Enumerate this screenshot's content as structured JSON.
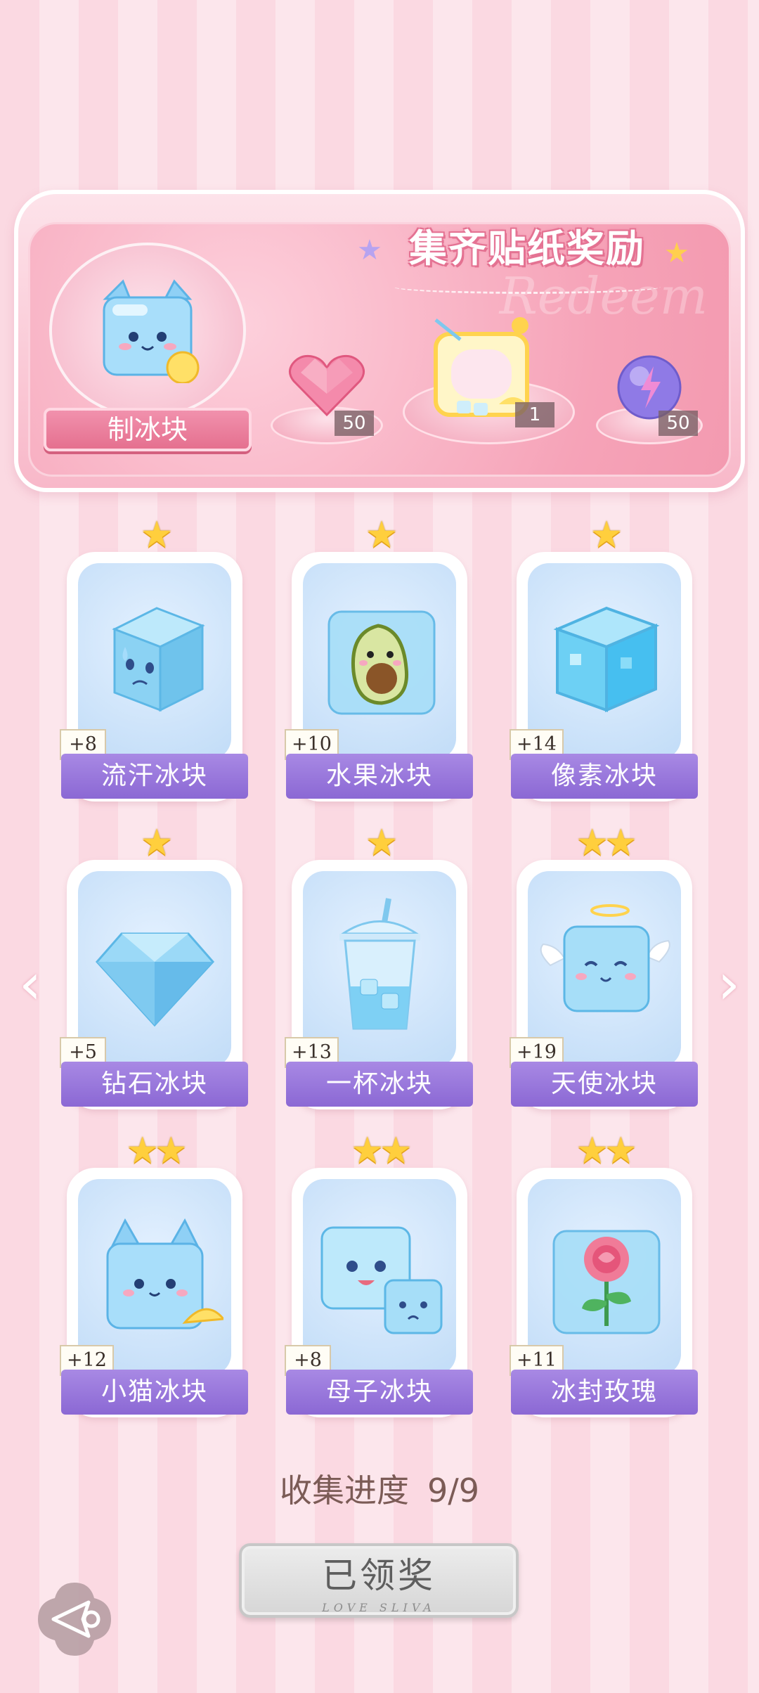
{
  "banner": {
    "title": "集齐贴纸奖励",
    "watermark": "Redeem",
    "main_reward_label": "制冰块",
    "rewards": [
      {
        "icon": "pink-heart-gem-icon",
        "qty": "50"
      },
      {
        "icon": "lemon-drink-frame-icon",
        "qty": "1"
      },
      {
        "icon": "purple-energy-orb-icon",
        "qty": "50"
      }
    ]
  },
  "cards": [
    {
      "name": "流汗冰块",
      "bonus": "+8",
      "stars": "★",
      "star_count": 1,
      "icon": "sweating-ice-cube-icon"
    },
    {
      "name": "水果冰块",
      "bonus": "+10",
      "stars": "★",
      "star_count": 1,
      "icon": "avocado-ice-cube-icon"
    },
    {
      "name": "像素冰块",
      "bonus": "+14",
      "stars": "★",
      "star_count": 1,
      "icon": "pixel-ice-cube-icon"
    },
    {
      "name": "钻石冰块",
      "bonus": "+5",
      "stars": "★",
      "star_count": 1,
      "icon": "diamond-ice-icon"
    },
    {
      "name": "一杯冰块",
      "bonus": "+13",
      "stars": "★",
      "star_count": 1,
      "icon": "cup-of-ice-icon"
    },
    {
      "name": "天使冰块",
      "bonus": "+19",
      "stars": "★★",
      "star_count": 2,
      "icon": "angel-ice-cube-icon"
    },
    {
      "name": "小猫冰块",
      "bonus": "+12",
      "stars": "★★",
      "star_count": 2,
      "icon": "cat-ice-cube-icon"
    },
    {
      "name": "母子冰块",
      "bonus": "+8",
      "stars": "★★",
      "star_count": 2,
      "icon": "mother-child-ice-cube-icon"
    },
    {
      "name": "冰封玫瑰",
      "bonus": "+11",
      "stars": "★★",
      "star_count": 2,
      "icon": "frozen-rose-icon"
    }
  ],
  "progress": {
    "label": "收集进度",
    "value": "9/9"
  },
  "claim_button": {
    "label": "已领奖",
    "sub": "LOVE SLIVA"
  },
  "nav": {
    "prev": "‹",
    "next": "›"
  },
  "colors": {
    "accent_pink": "#e5708f",
    "card_label_purple": "#8b68d4",
    "star_gold": "#ffcf3d"
  }
}
